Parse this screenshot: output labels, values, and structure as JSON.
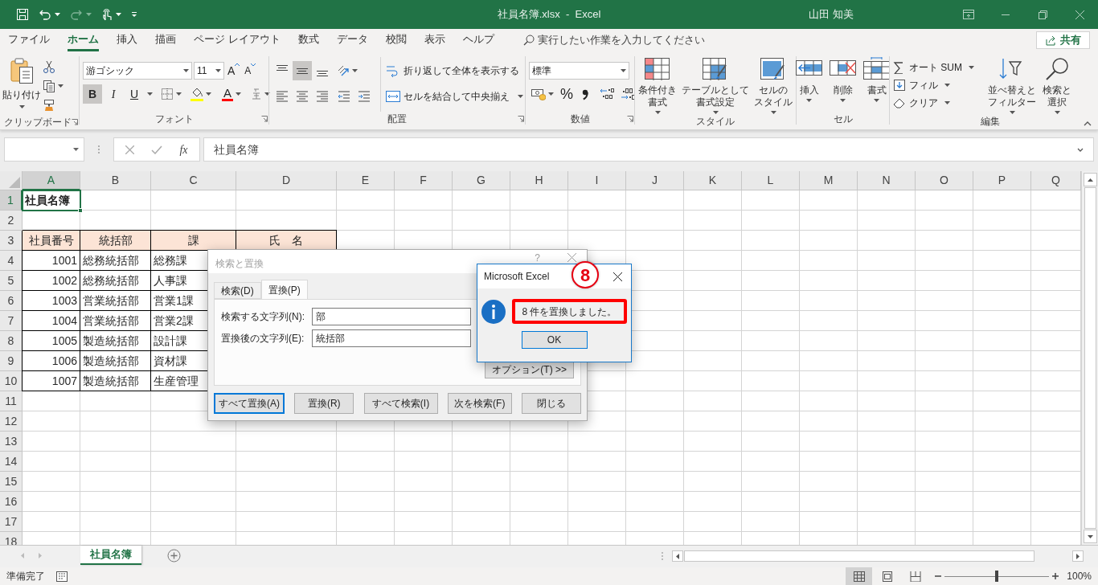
{
  "title_bar": {
    "title": "社員名簿.xlsx  -  Excel",
    "user": "山田 知美"
  },
  "menu_tabs": [
    {
      "label": "ファイル",
      "selected": false
    },
    {
      "label": "ホーム",
      "selected": true
    },
    {
      "label": "挿入",
      "selected": false
    },
    {
      "label": "描画",
      "selected": false
    },
    {
      "label": "ページ レイアウト",
      "selected": false
    },
    {
      "label": "数式",
      "selected": false
    },
    {
      "label": "データ",
      "selected": false
    },
    {
      "label": "校閲",
      "selected": false
    },
    {
      "label": "表示",
      "selected": false
    },
    {
      "label": "ヘルプ",
      "selected": false
    }
  ],
  "tell_me": {
    "placeholder": "実行したい作業を入力してください"
  },
  "share_button": "共有",
  "ribbon": {
    "clipboard": {
      "label": "クリップボード",
      "paste": "貼り付け"
    },
    "font": {
      "label": "フォント",
      "font_name": "游ゴシック",
      "font_size": "11",
      "grow": "A",
      "shrink": "A",
      "styles": [
        {
          "text": "B",
          "selected": true
        },
        {
          "text": "I",
          "selected": false
        },
        {
          "text": "U",
          "selected": false
        }
      ],
      "font_color": "A"
    },
    "alignment": {
      "label": "配置",
      "vertical": [
        {
          "selected": false
        },
        {
          "selected": true
        },
        {
          "selected": false
        }
      ],
      "wrap_text": "折り返して全体を表示する",
      "merge_center": "セルを結合して中央揃え"
    },
    "number": {
      "label": "数値",
      "format": "標準",
      "percent": "%"
    },
    "styles": {
      "label": "スタイル",
      "buttons": [
        [
          "条件付き",
          "書式"
        ],
        [
          "テーブルとして",
          "書式設定"
        ],
        [
          "セルの",
          "スタイル"
        ]
      ]
    },
    "cells": {
      "label": "セル",
      "buttons": [
        [
          "挿入"
        ],
        [
          "削除"
        ],
        [
          "書式"
        ]
      ]
    },
    "editing": {
      "label": "編集",
      "small": [
        "オート SUM",
        "フィル",
        "クリア"
      ],
      "large": [
        [
          "並べ替えと",
          "フィルター"
        ],
        [
          "検索と",
          "選択"
        ]
      ]
    }
  },
  "formula_bar": {
    "function_label": "fx",
    "value": "社員名簿"
  },
  "sheet": {
    "columns": [
      {
        "label": "A",
        "selected": true
      },
      {
        "label": "B",
        "selected": false
      },
      {
        "label": "C",
        "selected": false
      },
      {
        "label": "D",
        "selected": false
      },
      {
        "label": "E",
        "selected": false
      },
      {
        "label": "F",
        "selected": false
      },
      {
        "label": "G",
        "selected": false
      },
      {
        "label": "H",
        "selected": false
      },
      {
        "label": "I",
        "selected": false
      },
      {
        "label": "J",
        "selected": false
      },
      {
        "label": "K",
        "selected": false
      },
      {
        "label": "L",
        "selected": false
      },
      {
        "label": "M",
        "selected": false
      },
      {
        "label": "N",
        "selected": false
      },
      {
        "label": "O",
        "selected": false
      },
      {
        "label": "P",
        "selected": false
      },
      {
        "label": "Q",
        "selected": false
      }
    ],
    "rows": [
      {
        "number": "1",
        "selected": true,
        "cells": [
          {
            "text": "社員名簿",
            "kind": "title",
            "selected": true
          }
        ]
      },
      {
        "number": "2",
        "selected": false
      },
      {
        "number": "3",
        "selected": false,
        "cells": [
          {
            "text": "社員番号",
            "kind": "header",
            "selected": false
          },
          {
            "text": "統括部",
            "kind": "header",
            "selected": false
          },
          {
            "text": "課",
            "kind": "header",
            "selected": false
          },
          {
            "text": "氏　名",
            "kind": "header",
            "selected": false
          }
        ]
      },
      {
        "number": "4",
        "selected": false,
        "cells": [
          {
            "text": "1001",
            "kind": "number",
            "selected": false
          },
          {
            "text": "総務統括部",
            "kind": "text",
            "selected": false
          },
          {
            "text": "総務課",
            "kind": "text",
            "selected": false
          }
        ]
      },
      {
        "number": "5",
        "selected": false,
        "cells": [
          {
            "text": "1002",
            "kind": "number",
            "selected": false
          },
          {
            "text": "総務統括部",
            "kind": "text",
            "selected": false
          },
          {
            "text": "人事課",
            "kind": "text",
            "selected": false
          }
        ]
      },
      {
        "number": "6",
        "selected": false,
        "cells": [
          {
            "text": "1003",
            "kind": "number",
            "selected": false
          },
          {
            "text": "営業統括部",
            "kind": "text",
            "selected": false
          },
          {
            "text": "営業1課",
            "kind": "text",
            "selected": false
          }
        ]
      },
      {
        "number": "7",
        "selected": false,
        "cells": [
          {
            "text": "1004",
            "kind": "number",
            "selected": false
          },
          {
            "text": "営業統括部",
            "kind": "text",
            "selected": false
          },
          {
            "text": "営業2課",
            "kind": "text",
            "selected": false
          }
        ]
      },
      {
        "number": "8",
        "selected": false,
        "cells": [
          {
            "text": "1005",
            "kind": "number",
            "selected": false
          },
          {
            "text": "製造統括部",
            "kind": "text",
            "selected": false
          },
          {
            "text": "設計課",
            "kind": "text",
            "selected": false
          }
        ]
      },
      {
        "number": "9",
        "selected": false,
        "cells": [
          {
            "text": "1006",
            "kind": "number",
            "selected": false
          },
          {
            "text": "製造統括部",
            "kind": "text",
            "selected": false
          },
          {
            "text": "資材課",
            "kind": "text",
            "selected": false
          }
        ]
      },
      {
        "number": "10",
        "selected": false,
        "cells": [
          {
            "text": "1007",
            "kind": "number",
            "selected": false
          },
          {
            "text": "製造統括部",
            "kind": "text",
            "selected": false
          },
          {
            "text": "生産管理",
            "kind": "text",
            "selected": false
          }
        ]
      },
      {
        "number": "11",
        "selected": false
      },
      {
        "number": "12",
        "selected": false
      },
      {
        "number": "13",
        "selected": false
      },
      {
        "number": "14",
        "selected": false
      },
      {
        "number": "15",
        "selected": false
      },
      {
        "number": "16",
        "selected": false
      },
      {
        "number": "17",
        "selected": false
      },
      {
        "number": "18",
        "selected": false
      }
    ]
  },
  "sheet_tabs": [
    {
      "label": "社員名簿",
      "selected": true
    }
  ],
  "status_bar": {
    "text": "準備完了",
    "views": [
      {
        "selected": true
      },
      {
        "selected": false
      },
      {
        "selected": false
      }
    ],
    "zoom": {
      "level": 0.5,
      "reading": "100%"
    }
  },
  "find_dialog": {
    "title": "検索と置換",
    "help": "?",
    "tabs": [
      {
        "label": "検索(D)",
        "selected": false
      },
      {
        "label": "置換(P)",
        "selected": true
      }
    ],
    "fields": [
      {
        "label": "検索する文字列(N):",
        "value": "部"
      },
      {
        "label": "置換後の文字列(E):",
        "value": "統括部"
      }
    ],
    "options_button": "オプション(T) >>",
    "buttons": [
      {
        "label": "すべて置換(A)",
        "default": true
      },
      {
        "label": "置換(R)",
        "default": false
      },
      {
        "label": "すべて検索(I)",
        "default": false
      },
      {
        "label": "次を検索(F)",
        "default": false
      },
      {
        "label": "閉じる",
        "default": false
      }
    ]
  },
  "message_box": {
    "title": "Microsoft Excel",
    "message": "8 件を置換しました。",
    "highlighted": true,
    "button": "OK",
    "step_marker": "8"
  }
}
